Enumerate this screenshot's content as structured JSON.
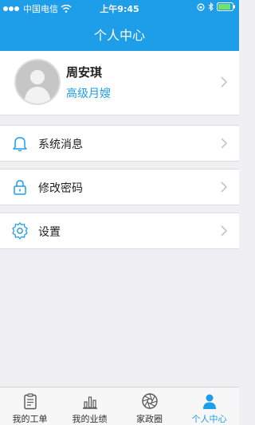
{
  "status_bar": {
    "carrier": "中国电信",
    "time": "上午9:45"
  },
  "nav": {
    "title": "个人中心"
  },
  "profile": {
    "name": "周安琪",
    "role": "高级月嫂"
  },
  "menu": [
    {
      "label": "系统消息",
      "icon": "bell-icon"
    },
    {
      "label": "修改密码",
      "icon": "lock-icon"
    },
    {
      "label": "设置",
      "icon": "gear-icon"
    }
  ],
  "tabs": [
    {
      "label": "我的工单",
      "icon": "clipboard-icon"
    },
    {
      "label": "我的业绩",
      "icon": "bar-chart-icon"
    },
    {
      "label": "家政圈",
      "icon": "aperture-icon"
    },
    {
      "label": "个人中心",
      "icon": "person-icon"
    }
  ],
  "colors": {
    "accent": "#1e9ee8",
    "background": "#efeff4"
  }
}
